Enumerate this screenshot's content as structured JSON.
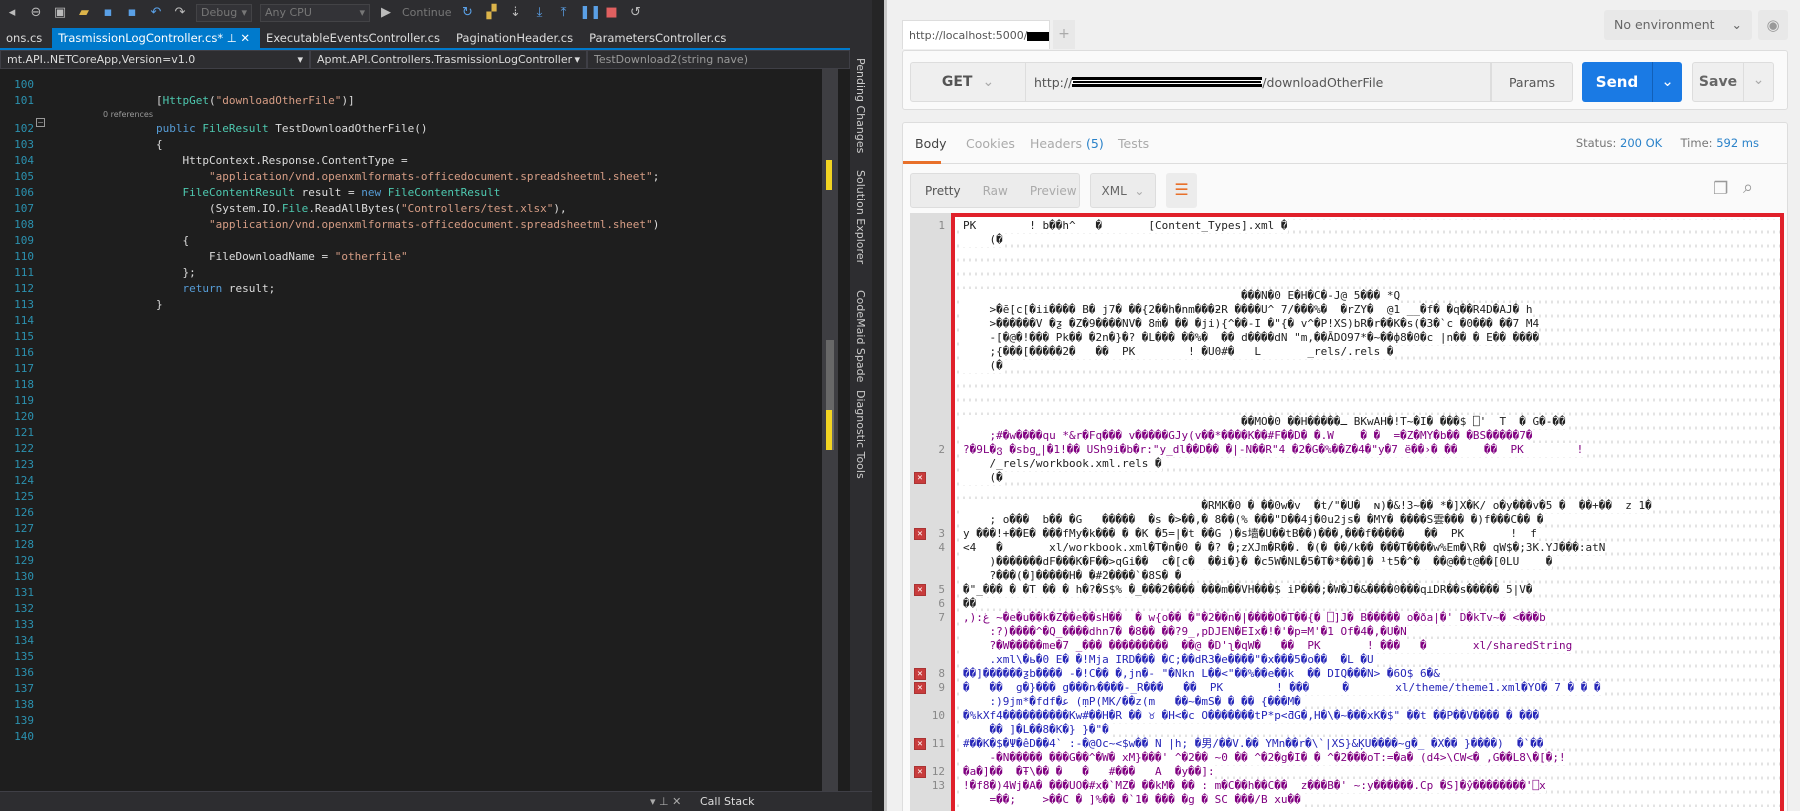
{
  "vs": {
    "toolbar": {
      "config": "Debug",
      "platform": "Any CPU",
      "continue": "Continue"
    },
    "tabs": [
      {
        "label": "ons.cs",
        "active": false
      },
      {
        "label": "TrasmissionLogController.cs*",
        "active": true
      },
      {
        "label": "ExecutableEventsController.cs",
        "active": false
      },
      {
        "label": "PaginationHeader.cs",
        "active": false
      },
      {
        "label": "ParametersController.cs",
        "active": false
      }
    ],
    "nav": {
      "project": "mt.API..NETCoreApp,Version=v1.0",
      "class": "Apmt.API.Controllers.TrasmissionLogController",
      "member": "TestDownload2(string nave)"
    },
    "code_lines": [
      {
        "n": "100",
        "t": []
      },
      {
        "n": "101",
        "t": [
          [
            "p",
            "        ["
          ],
          [
            "t",
            "HttpGet"
          ],
          [
            "p",
            "("
          ],
          [
            "s",
            "\"downloadOtherFile\""
          ],
          [
            "p",
            ")]"
          ]
        ]
      },
      {
        "lens": "0 references"
      },
      {
        "n": "102",
        "t": [
          [
            "k",
            "        public "
          ],
          [
            "t",
            "FileResult"
          ],
          [
            "p",
            " TestDownloadOtherFile()"
          ]
        ]
      },
      {
        "n": "103",
        "t": [
          [
            "p",
            "        {"
          ]
        ]
      },
      {
        "n": "104",
        "t": [
          [
            "p",
            "            HttpContext.Response.ContentType ="
          ]
        ]
      },
      {
        "n": "105",
        "t": [
          [
            "s",
            "                \"application/vnd.openxmlformats-officedocument.spreadsheetml.sheet\""
          ],
          [
            "p",
            ";"
          ]
        ]
      },
      {
        "n": "106",
        "t": [
          [
            "t",
            "            FileContentResult"
          ],
          [
            "p",
            " result = "
          ],
          [
            "k",
            "new "
          ],
          [
            "t",
            "FileContentResult"
          ]
        ]
      },
      {
        "n": "107",
        "t": [
          [
            "p",
            "                (System.IO."
          ],
          [
            "t",
            "File"
          ],
          [
            "p",
            ".ReadAllBytes("
          ],
          [
            "s",
            "\"Controllers/test.xlsx\""
          ],
          [
            "p",
            "),"
          ]
        ]
      },
      {
        "n": "108",
        "t": [
          [
            "s",
            "                \"application/vnd.openxmlformats-officedocument.spreadsheetml.sheet\""
          ],
          [
            "p",
            ")"
          ]
        ]
      },
      {
        "n": "109",
        "t": [
          [
            "p",
            "            {"
          ]
        ]
      },
      {
        "n": "110",
        "t": [
          [
            "p",
            "                FileDownloadName = "
          ],
          [
            "s",
            "\"otherfile\""
          ]
        ]
      },
      {
        "n": "111",
        "t": [
          [
            "p",
            "            };"
          ]
        ]
      },
      {
        "n": "112",
        "t": [
          [
            "k",
            "            return"
          ],
          [
            "p",
            " result;"
          ]
        ]
      },
      {
        "n": "113",
        "t": [
          [
            "p",
            "        }"
          ]
        ]
      },
      {
        "n": "114",
        "t": []
      },
      {
        "n": "115",
        "t": []
      },
      {
        "n": "116",
        "t": []
      },
      {
        "n": "117",
        "t": []
      },
      {
        "n": "118",
        "t": []
      },
      {
        "n": "119",
        "t": []
      },
      {
        "n": "120",
        "t": []
      },
      {
        "n": "121",
        "t": []
      },
      {
        "n": "122",
        "t": []
      },
      {
        "n": "123",
        "t": []
      },
      {
        "n": "124",
        "t": []
      },
      {
        "n": "125",
        "t": []
      },
      {
        "n": "126",
        "t": []
      },
      {
        "n": "127",
        "t": []
      },
      {
        "n": "128",
        "t": []
      },
      {
        "n": "129",
        "t": []
      },
      {
        "n": "130",
        "t": []
      },
      {
        "n": "131",
        "t": []
      },
      {
        "n": "132",
        "t": []
      },
      {
        "n": "133",
        "t": []
      },
      {
        "n": "134",
        "t": []
      },
      {
        "n": "135",
        "t": []
      },
      {
        "n": "136",
        "t": []
      },
      {
        "n": "137",
        "t": []
      },
      {
        "n": "138",
        "t": []
      },
      {
        "n": "139",
        "t": []
      },
      {
        "n": "140",
        "t": []
      }
    ],
    "side_tabs": [
      "Pending Changes",
      "Solution Explorer",
      "CodeMaid Spade",
      "Diagnostic Tools"
    ],
    "bottom_panel": "Call Stack",
    "colors": {
      "accent": "#007acc",
      "keyword": "#569cd6",
      "type": "#4ec9b0",
      "string": "#d69d85"
    }
  },
  "postman": {
    "tab_url": "http://localhost:5000/",
    "environment": "No environment",
    "method": "GET",
    "url_prefix": "http://",
    "url_suffix": "/downloadOtherFile",
    "params_label": "Params",
    "send_label": "Send",
    "save_label": "Save",
    "response_tabs": {
      "body": "Body",
      "cookies": "Cookies",
      "headers": "Headers",
      "headers_count": "(5)",
      "tests": "Tests"
    },
    "status_label": "Status:",
    "status_value": "200 OK",
    "time_label": "Time:",
    "time_value": "592 ms",
    "format_tabs": [
      "Pretty",
      "Raw",
      "Preview"
    ],
    "format": "XML",
    "colors": {
      "send": "#1a7ae4",
      "active_tab": "#e8702a",
      "highlight_border": "#e0202a"
    },
    "body_rows": [
      {
        "n": "1",
        "c": "k",
        "t": "PK        ! b��h^   �       [Content_Types].xml �"
      },
      {
        "c": "k",
        "t": "    (�"
      },
      {
        "c": "k",
        "t": ""
      },
      {
        "c": "k",
        "t": ""
      },
      {
        "c": "k",
        "t": ""
      },
      {
        "c": "k",
        "t": "                                          ���N�0 E�H�C�-J@ 5��� *Q"
      },
      {
        "c": "k",
        "t": "    >�ē[c[�ii���� B� j7� ��{2��h�nm���ƻR ����U^ 7/���%�  �rZY�  @1 __�f� �q��R4D�AJ� h"
      },
      {
        "c": "k",
        "t": "    >������V �ƺ �Z�9����NV� 8ṁ� �� �ji){^��-I �\"{� v^�P!XS)bR�r��K�s(�3�`c �0��� ��7 M4"
      },
      {
        "c": "k",
        "t": "    -[�@�!��� Pk�� �2n�}�? �L��� ��%�  �� d����dN \"m,��ĀDO97*�~��ф8�0�c |n�� � E�� ����"
      },
      {
        "c": "k",
        "t": "    ;{���[�����2�   ��  PK        ! �U0#�   L       _rels/.rels �"
      },
      {
        "c": "k",
        "t": "    (�"
      },
      {
        "c": "k",
        "t": ""
      },
      {
        "c": "k",
        "t": ""
      },
      {
        "c": "k",
        "t": ""
      },
      {
        "c": "k",
        "t": "                                          ��MO�0 ��H�����ـ BKwAH�!T~�I� ���$ ⎕'  T  � G�-��"
      },
      {
        "c": "p",
        "t": "    ;#�w����qu *&r�Fq��� v�����GJy(v��*����K��#F��D� �.W    � �  =�Z�MY�b�� �BS�����7�"
      },
      {
        "n": "2",
        "c": "p",
        "t": "?�9L�ვ �sbg⎵|�1!�� USh9i�b�r:\"y_dl��D�� �|-N��R\"4 �2�G�%��Z�4�\"y�7 ë��›� ��    ��  PK        !"
      },
      {
        "c": "k",
        "t": "    /_rels/workbook.xml.rels �"
      },
      {
        "err": true,
        "c": "k",
        "t": "    (�"
      },
      {
        "c": "k",
        "t": ""
      },
      {
        "c": "k",
        "t": "                                    �RMK�0 � ��0w�v  �t/\"�U�  ɴ)�&!3~�� *�]X�K/ o�y���v�5 �  ��+��  z 1�"
      },
      {
        "c": "k",
        "t": "    ; o���  b�� �G   �����  �s �>��,� 8��(% ���\"D��4j�0u2js� �MY� ����S雲��� �)f���C�� �"
      },
      {
        "n": "3",
        "err": true,
        "c": "k",
        "t": "y ���!+��E� ���fMy�k��� � �K �5=|�t ��G )�s墙�U��tB��)���,���f�����   ��  PK       !  f"
      },
      {
        "n": "4",
        "c": "k",
        "t": "<4   �       xl/workbook.xml�T�n�0 � �? �;zXJm�R��. �(� ��/k�� ���T����w%Em�\\R� qW$�;3K.YJ���:atN"
      },
      {
        "c": "k",
        "t": "    )�������dF���K�F��>qGi��  c�[c�  ��i�}� �c5W�NL�5�T�*���]� ¹t5�^�  ��@��t@��[0LU    �"
      },
      {
        "c": "k",
        "t": "    ?���(�]�����H� �#2����`�8S� �"
      },
      {
        "n": "5",
        "err": true,
        "c": "k",
        "t": "�\"_��� � �T �� � h�?�S$% �_���2���� ���m��VH���$ iP���;�W�J�&����0���q⊥DR��s����� 5|V�"
      },
      {
        "n": "6",
        "c": "k",
        "t": "��"
      },
      {
        "n": "7",
        "c": "p",
        "t": ",):ﻍ ~�e�u��k�Z��e��sH��  � w{o�� �\"�2��n�|����O�T��{� ⎕]J� B����� o�ða|�' D�kTv~� <���b"
      },
      {
        "c": "p",
        "t": "    :?)����^�Q_����dhn7� �8�� ��?9_,pDJEN�EIx�!�'�p=M'�1 Of�4�,�U�N"
      },
      {
        "c": "p",
        "t": "    ?�W�����me�7 _��� ���������  ��@ �D'ʅ�qW�   ��  PK       ! ���   �       xl/sharedString"
      },
      {
        "c": "b",
        "t": "    .xml\\�ь�0 E� �!Mja IRD��� �C;��dR3�e����\"�x���5�o��  �L �U"
      },
      {
        "n": "8",
        "err": true,
        "c": "b",
        "t": "��]������ƺb���� -�!C�� �,jn�- \"�Nkn L��<\"��%��e��k  �� DIQ���N> �6O$ 6�&"
      },
      {
        "n": "9",
        "err": true,
        "c": "b",
        "t": "�   ��  g�}��� g���n⁄����-_R���   ��  PK        ! ���     �       xl/theme/theme1.xml�YO� 7 � � �"
      },
      {
        "c": "b",
        "t": "    :)9jm*�fdf�ﻋ (ṃP(MK/��z(m   ��~�mS� � �� {���M�"
      },
      {
        "n": "10",
        "c": "b",
        "t": "�%kXf4����������Kw#��H�R �� ♉ �H<�c O�������tP*p<ƌG�,H�\\�~���xK�$\" ��t ��P��V���� � ���"
      },
      {
        "c": "b",
        "t": "    �� ]�L��8�K�} }�\"�"
      },
      {
        "n": "11",
        "err": true,
        "c": "b",
        "t": "#��K�$�Ψ�êD��4` :-�@Oc~<$w�� N |h; �男/��V.�� YMn��r�\\`|XS}&ĶU����~g�_ �X�� }����)  �`��"
      },
      {
        "c": "p",
        "t": "    -�N����� ���G��^�W� xM}���' ^�2�� ~0 �� ^�2�g�I� � ^�2���oT:=�a� (d4>\\CW<� ,G��L8\\�[�;!"
      },
      {
        "n": "12",
        "err": true,
        "c": "p",
        "t": "�a�]��  �Ŧ\\�� �   �   #���   A  �y��]:"
      },
      {
        "n": "13",
        "c": "p",
        "t": "!�f8�)4Wj�A� ���UO�#x�`MZ� ��kM� �� : m�C��h��C��  z���B�' ~:y������.Cp �S]�ŷ��������'⎕x"
      },
      {
        "c": "p",
        "t": "    =��;    >��C � ]%�� �`1� ��� �g � SC ���/B xu��"
      }
    ]
  }
}
